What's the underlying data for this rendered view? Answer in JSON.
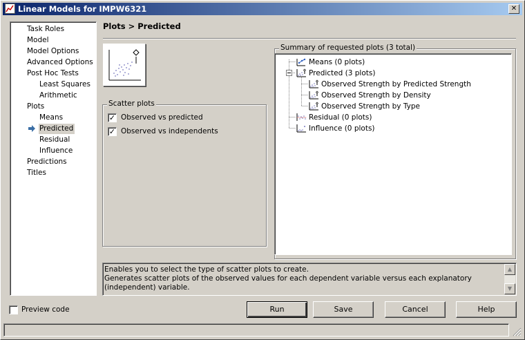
{
  "window": {
    "title": "Linear Models for IMPW6321",
    "close_glyph": "✕"
  },
  "nav": {
    "items": [
      {
        "label": "Task Roles",
        "level": 0
      },
      {
        "label": "Model",
        "level": 0
      },
      {
        "label": "Model Options",
        "level": 0
      },
      {
        "label": "Advanced Options",
        "level": 0
      },
      {
        "label": "Post Hoc Tests",
        "level": 0
      },
      {
        "label": "Least Squares",
        "level": 1
      },
      {
        "label": "Arithmetic",
        "level": 1
      },
      {
        "label": "Plots",
        "level": 0
      },
      {
        "label": "Means",
        "level": 1
      },
      {
        "label": "Predicted",
        "level": 1,
        "selected": true
      },
      {
        "label": "Residual",
        "level": 1
      },
      {
        "label": "Influence",
        "level": 1
      },
      {
        "label": "Predictions",
        "level": 0
      },
      {
        "label": "Titles",
        "level": 0
      }
    ]
  },
  "page": {
    "title": "Plots > Predicted"
  },
  "scatter": {
    "legend": "Scatter plots",
    "options": [
      {
        "label": "Observed vs predicted",
        "checked": true
      },
      {
        "label": "Observed vs independents",
        "checked": true
      }
    ]
  },
  "summary": {
    "legend": "Summary of requested plots (3 total)",
    "nodes": [
      {
        "label": "Means (0 plots)",
        "icon": "means-plot-icon"
      },
      {
        "label": "Predicted (3 plots)",
        "icon": "scatter-plot-icon",
        "expanded": true
      },
      {
        "label": "Observed Strength by Predicted Strength",
        "icon": "scatter-plot-icon",
        "child": true
      },
      {
        "label": "Observed Strength by Density",
        "icon": "scatter-plot-icon",
        "child": true
      },
      {
        "label": "Observed Strength by Type",
        "icon": "scatter-plot-icon",
        "child": true
      },
      {
        "label": "Residual (0 plots)",
        "icon": "residual-plot-icon"
      },
      {
        "label": "Influence (0 plots)",
        "icon": "influence-plot-icon"
      }
    ]
  },
  "description": {
    "line1": "Enables you to select the type of scatter plots to create.",
    "line2": "Generates scatter plots of the observed values for each dependent variable versus each explanatory (independent) variable."
  },
  "footer": {
    "preview_label": "Preview code",
    "preview_checked": false,
    "buttons": {
      "run": "Run",
      "save": "Save",
      "cancel": "Cancel",
      "help": "Help"
    }
  },
  "colors": {
    "titlebar_start": "#0a246a",
    "titlebar_end": "#a6caf0",
    "face": "#d4d0c8",
    "arrow": "#3a6ea5"
  }
}
